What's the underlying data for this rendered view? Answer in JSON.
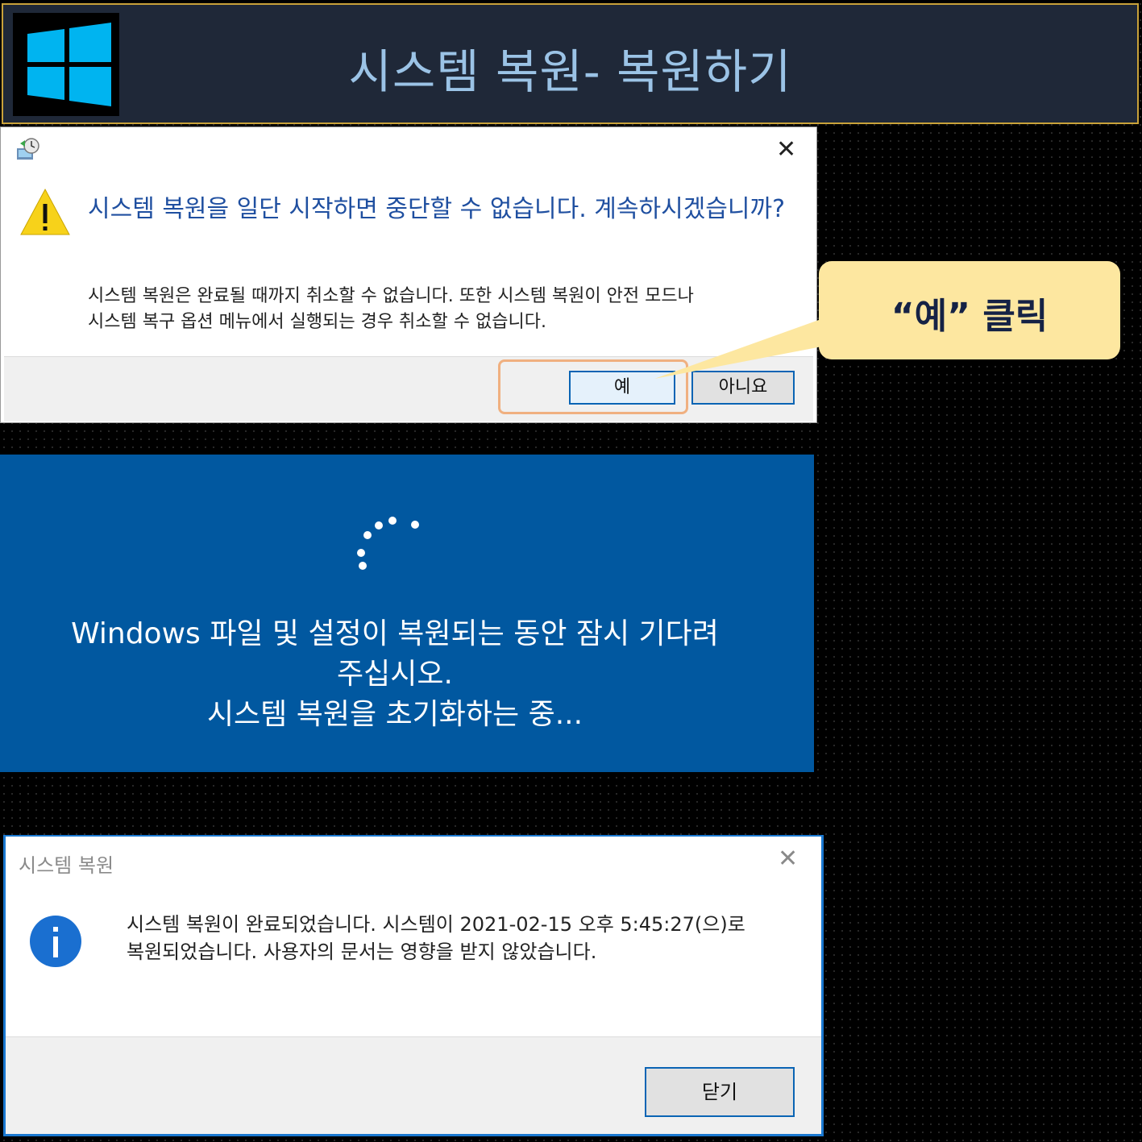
{
  "header": {
    "title": "시스템 복원- 복원하기",
    "logo_icon": "windows-logo-icon",
    "logo_color": "#00b4f0"
  },
  "confirm_dialog": {
    "icon": "system-restore-icon",
    "close_icon": "close-icon",
    "warning_icon": "warning-icon",
    "headline": "시스템 복원을 일단 시작하면 중단할 수 없습니다. 계속하시겠습니까?",
    "body_line1": "시스템 복원은 완료될 때까지 취소할 수 없습니다. 또한 시스템 복원이 안전 모드나",
    "body_line2": "시스템 복구 옵션 메뉴에서 실행되는 경우 취소할 수 없습니다.",
    "yes_label": "예",
    "no_label": "아니요"
  },
  "callout": {
    "text": "“예” 클릭",
    "color": "#fde7a0"
  },
  "progress_screen": {
    "line1": "Windows 파일 및 설정이 복원되는 동안 잠시 기다려",
    "line2": "주십시오.",
    "status": "시스템 복원을 초기화하는 중...",
    "background": "#0158a0"
  },
  "complete_dialog": {
    "title": "시스템 복원",
    "info_icon": "info-icon",
    "message_line1": "시스템 복원이 완료되었습니다. 시스템이 2021-02-15 오후 5:45:27(으)로",
    "message_line2": "복원되었습니다. 사용자의 문서는 영향을 받지 않았습니다.",
    "close_label": "닫기"
  }
}
